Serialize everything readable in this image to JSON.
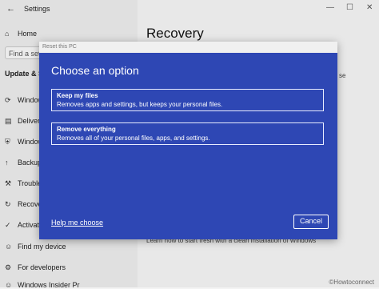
{
  "window": {
    "title": "Settings",
    "back_icon": "back-arrow-icon"
  },
  "sidebar": {
    "home": "Home",
    "search_placeholder": "Find a setti",
    "section": "Update & Se",
    "items": [
      {
        "label": "Window",
        "icon": "windows-update-icon"
      },
      {
        "label": "Delivery",
        "icon": "delivery-icon"
      },
      {
        "label": "Window",
        "icon": "shield-icon"
      },
      {
        "label": "Backup",
        "icon": "backup-icon"
      },
      {
        "label": "Troubles",
        "icon": "wrench-icon"
      },
      {
        "label": "Recovery",
        "icon": "recovery-icon"
      },
      {
        "label": "Activatio",
        "icon": "activation-icon"
      },
      {
        "label": "Find my device",
        "icon": "person-icon"
      },
      {
        "label": "For developers",
        "icon": "developer-icon"
      },
      {
        "label": "Windows Insider Pr",
        "icon": "insider-icon"
      }
    ]
  },
  "main": {
    "title": "Recovery",
    "peek_right": "se",
    "peek_bottom": "Learn how to start fresh with a clean installation of Windows"
  },
  "dialog": {
    "caption": "Reset this PC",
    "title": "Choose an option",
    "options": [
      {
        "title": "Keep my files",
        "desc": "Removes apps and settings, but keeps your personal files."
      },
      {
        "title": "Remove everything",
        "desc": "Removes all of your personal files, apps, and settings."
      }
    ],
    "help": "Help me choose",
    "cancel": "Cancel"
  },
  "watermark": "©Howtoconnect"
}
